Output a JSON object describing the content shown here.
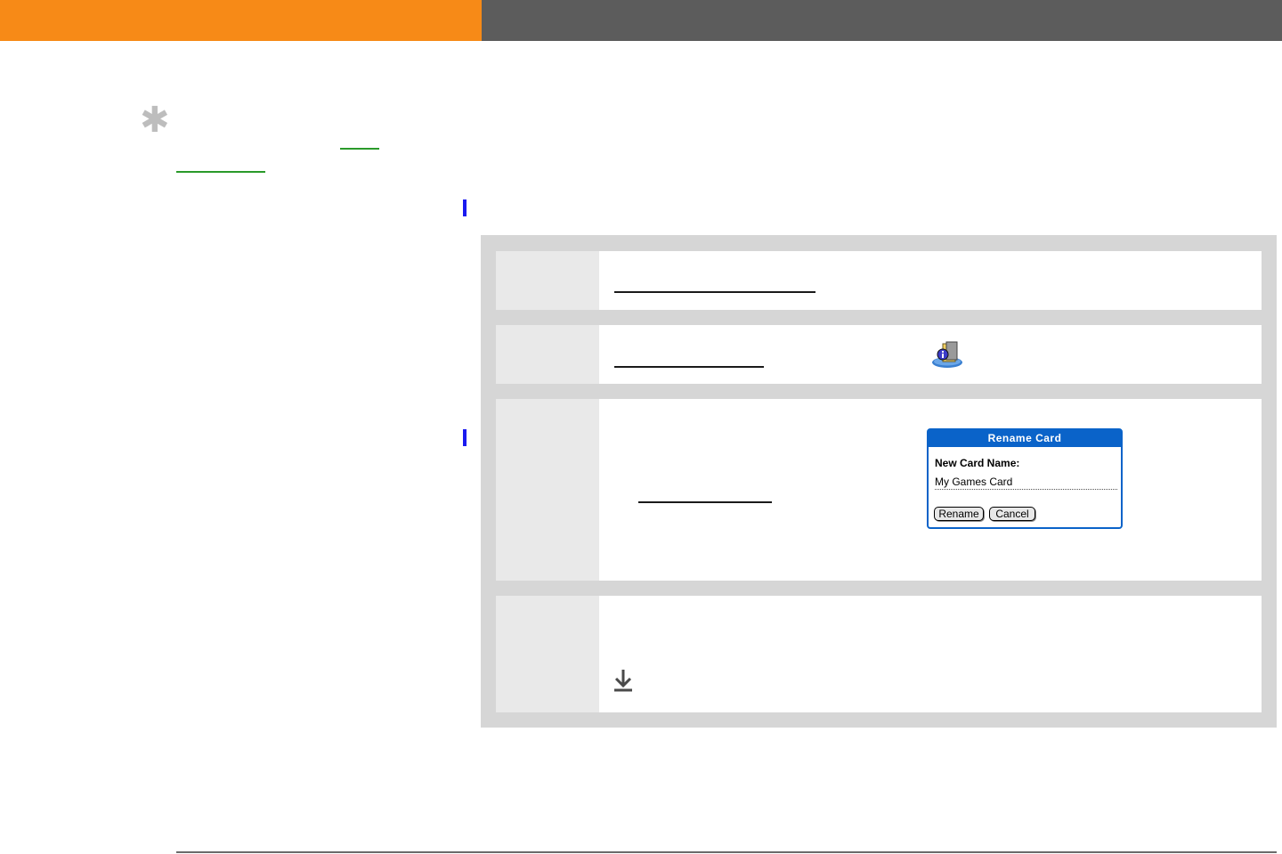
{
  "dialog": {
    "title": "Rename Card",
    "label": "New Card Name:",
    "value": "My Games Card",
    "rename_button": "Rename",
    "cancel_button": "Cancel"
  },
  "icons": {
    "tip": "asterisk-tip-icon",
    "app": "card-info-app-icon",
    "continued": "down-arrow-continued-icon"
  },
  "colors": {
    "header_accent": "#f78a17",
    "header_dark": "#5c5c5c",
    "change_bar": "#1a1af0",
    "dialog_blue": "#0a63c9",
    "link_green": "#2a9a2a"
  }
}
